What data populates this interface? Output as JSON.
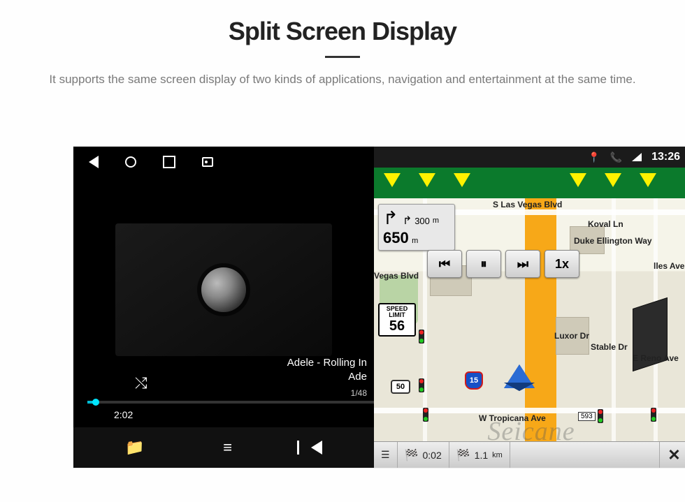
{
  "header": {
    "title": "Split Screen Display",
    "subtitle": "It supports the same screen display of two kinds of applications, navigation and entertainment at the same time."
  },
  "status": {
    "time": "13:26"
  },
  "music": {
    "track_line1": "Adele - Rolling In",
    "track_line2": "Ade",
    "counter": "1/48",
    "elapsed": "2:02"
  },
  "nav": {
    "turn_distance_value": "650",
    "turn_distance_unit": "m",
    "next_turn_value": "300",
    "next_turn_unit": "m",
    "speed_limit_label": "SPEED LIMIT",
    "speed_limit_value": "56",
    "playback_speed": "1x",
    "interstate": "15",
    "highway": "50",
    "exit_number": "593",
    "eta_time": "0:02",
    "eta_dist_value": "1.1",
    "eta_dist_unit": "km",
    "streets": {
      "top": "S Las Vegas Blvd",
      "duke": "Duke Ellington Way",
      "koval": "Koval Ln",
      "vegas2": "Vegas Blvd",
      "luxor": "Luxor Dr",
      "stable": "Stable Dr",
      "reno": "E Reno Ave",
      "lles": "lles Ave",
      "bottom": "W Tropicana Ave"
    }
  },
  "watermark": "Seicane"
}
